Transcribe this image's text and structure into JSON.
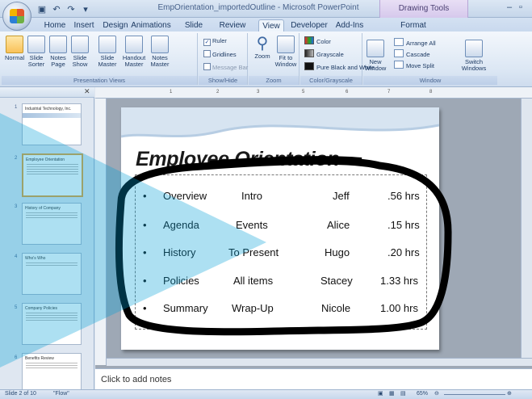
{
  "window": {
    "title": "EmpOrientation_importedOutline - Microsoft PowerPoint",
    "context_tab": "Drawing Tools"
  },
  "tabs": [
    {
      "label": "Home"
    },
    {
      "label": "Insert"
    },
    {
      "label": "Design"
    },
    {
      "label": "Animations"
    },
    {
      "label": "Slide Show"
    },
    {
      "label": "Review"
    },
    {
      "label": "View"
    },
    {
      "label": "Developer"
    },
    {
      "label": "Add-Ins"
    },
    {
      "label": "Format"
    }
  ],
  "ribbon": {
    "presentation_views": {
      "label": "Presentation Views",
      "buttons": [
        {
          "label": "Normal"
        },
        {
          "label": "Slide Sorter"
        },
        {
          "label": "Notes Page"
        },
        {
          "label": "Slide Show"
        },
        {
          "label": "Slide Master"
        },
        {
          "label": "Handout Master"
        },
        {
          "label": "Notes Master"
        }
      ]
    },
    "show_hide": {
      "label": "Show/Hide",
      "ruler": "Ruler",
      "gridlines": "Gridlines",
      "message_bar": "Message Bar"
    },
    "zoom": {
      "label": "Zoom",
      "zoom_btn": "Zoom",
      "fit_btn": "Fit to Window"
    },
    "color": {
      "label": "Color/Grayscale",
      "color": "Color",
      "grayscale": "Grayscale",
      "pure_bw": "Pure Black and White"
    },
    "window": {
      "label": "Window",
      "new_window": "New Window",
      "arrange_all": "Arrange All",
      "cascade": "Cascade",
      "move_split": "Move Split",
      "switch_windows": "Switch Windows"
    }
  },
  "slides_panel": {
    "thumbs": [
      {
        "num": "1",
        "title": "Industrial Technology, Inc."
      },
      {
        "num": "2",
        "title": "Employee Orientation"
      },
      {
        "num": "3",
        "title": "History of Company"
      },
      {
        "num": "4",
        "title": "Who's Who"
      },
      {
        "num": "5",
        "title": "Company Policies"
      },
      {
        "num": "6",
        "title": "Benefits Review"
      }
    ]
  },
  "slide": {
    "title": "Employee Orientation",
    "rows": [
      {
        "topic": "Overview",
        "desc": "Intro",
        "presenter": "Jeff",
        "time": ".56 hrs"
      },
      {
        "topic": "Agenda",
        "desc": "Events",
        "presenter": "Alice",
        "time": ".15 hrs"
      },
      {
        "topic": "History",
        "desc": "To Present",
        "presenter": "Hugo",
        "time": ".20 hrs"
      },
      {
        "topic": "Policies",
        "desc": "All items",
        "presenter": "Stacey",
        "time": "1.33 hrs"
      },
      {
        "topic": "Summary",
        "desc": "Wrap-Up",
        "presenter": "Nicole",
        "time": "1.00 hrs"
      }
    ]
  },
  "notes": {
    "placeholder": "Click to add notes"
  },
  "status": {
    "slide": "Slide 2 of 10",
    "theme": "\"Flow\"",
    "zoom": "65%"
  }
}
